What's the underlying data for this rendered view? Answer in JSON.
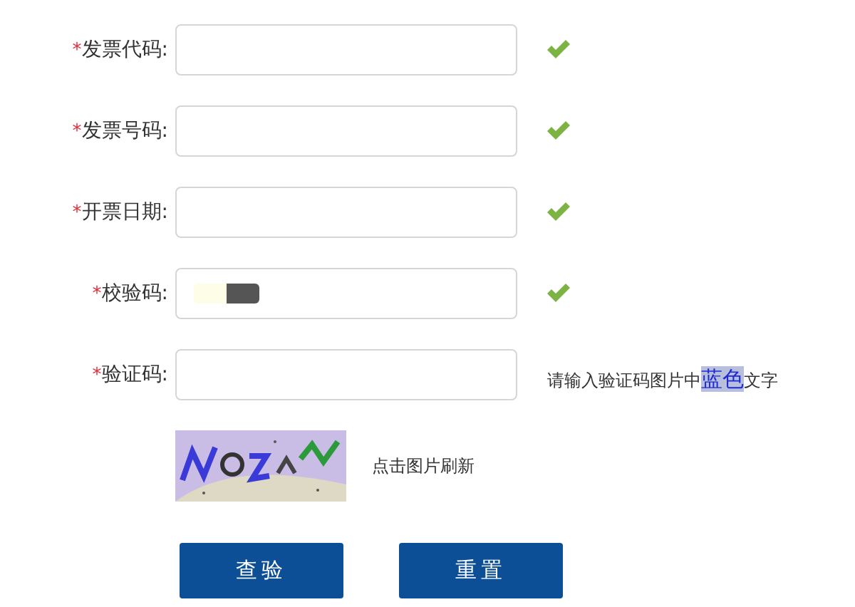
{
  "fields": [
    {
      "mark": "*",
      "label": "发票代码:",
      "valid": true,
      "redacted": false
    },
    {
      "mark": "*",
      "label": "发票号码:",
      "valid": true,
      "redacted": false
    },
    {
      "mark": "*",
      "label": "开票日期:",
      "valid": true,
      "redacted": false
    },
    {
      "mark": "*",
      "label": "校验码:",
      "valid": true,
      "redacted": true
    },
    {
      "mark": "*",
      "label": "验证码:",
      "valid": false,
      "redacted": false,
      "hint": {
        "before": "请输入验证码图片中",
        "highlight": "蓝色",
        "after": "文字"
      }
    }
  ],
  "captcha": {
    "kind": "picture",
    "caption": "点击图片刷新"
  },
  "buttons": [
    "查验",
    "重置"
  ]
}
